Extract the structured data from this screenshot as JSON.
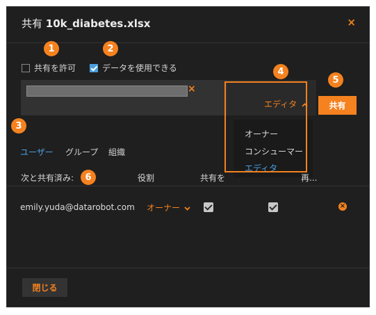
{
  "dialog": {
    "title_prefix": "共有",
    "title_file": "10k_diabetes.xlsx",
    "close_glyph": "×"
  },
  "options": {
    "allow_share_label": "共有を許可",
    "allow_share_checked": false,
    "use_data_label": "データを使用できる",
    "use_data_checked": true
  },
  "share_input": {
    "chip_remove_glyph": "×"
  },
  "role_select": {
    "selected": "エディタ",
    "options": [
      "オーナー",
      "コンシューマー",
      "エディタ"
    ]
  },
  "share_button_label": "共有",
  "tabs": [
    "ユーザー",
    "グループ",
    "組織"
  ],
  "table": {
    "headers": [
      "次と共有済み:",
      "役割",
      "共有を",
      "再..."
    ],
    "rows": [
      {
        "email": "emily.yuda@datarobot.com",
        "role": "オーナー",
        "can_share": true,
        "can_use_data": true
      }
    ]
  },
  "close_button_label": "閉じる",
  "annotations": [
    "1",
    "2",
    "3",
    "4",
    "5",
    "6"
  ],
  "colors": {
    "accent": "#f5821f",
    "link": "#4a9fe0",
    "background": "#1f1f1f"
  }
}
